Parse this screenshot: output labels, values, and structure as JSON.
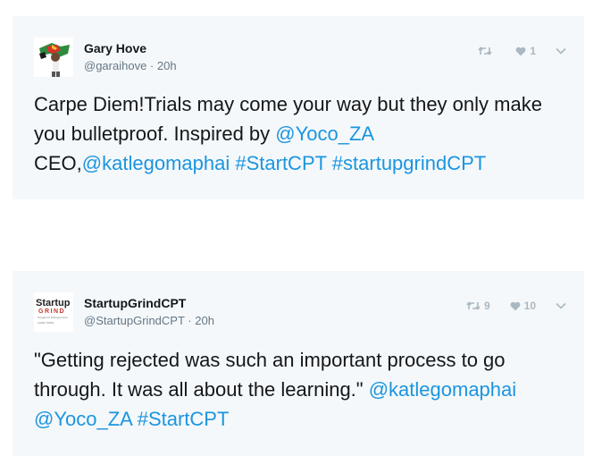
{
  "tweets": [
    {
      "author_name": "Gary Hove",
      "handle": "@garaihove",
      "time": "20h",
      "text_parts": [
        {
          "t": "Carpe Diem!Trials may come your way but they only make you bulletproof. Inspired by ",
          "link": false
        },
        {
          "t": "@Yoco_ZA",
          "link": true
        },
        {
          "t": " CEO,",
          "link": false
        },
        {
          "t": "@katlegomaphai",
          "link": true
        },
        {
          "t": " ",
          "link": false
        },
        {
          "t": "#StartCPT",
          "link": true
        },
        {
          "t": " ",
          "link": false
        },
        {
          "t": "#startupgrindCPT",
          "link": true
        }
      ],
      "retweet_count": "",
      "like_count": "1"
    },
    {
      "author_name": "StartupGrindCPT",
      "handle": "@StartupGrindCPT",
      "time": "20h",
      "avatar_logo_text": "Startup GRIND Google for Entrepreneurs CAPE TOWN",
      "text_parts": [
        {
          "t": "\"Getting rejected was such an important process to go through. It was all about the learning.\" ",
          "link": false
        },
        {
          "t": "@katlegomaphai",
          "link": true
        },
        {
          "t": " ",
          "link": false
        },
        {
          "t": "@Yoco_ZA",
          "link": true
        },
        {
          "t": " ",
          "link": false
        },
        {
          "t": "#StartCPT",
          "link": true
        }
      ],
      "retweet_count": "9",
      "like_count": "10"
    }
  ],
  "colors": {
    "card_bg": "#f5f8fa",
    "link": "#1b95e0",
    "muted": "#657786",
    "icon": "#aab8c2"
  },
  "icons": [
    "retweet-icon",
    "heart-icon",
    "chevron-down-icon"
  ]
}
